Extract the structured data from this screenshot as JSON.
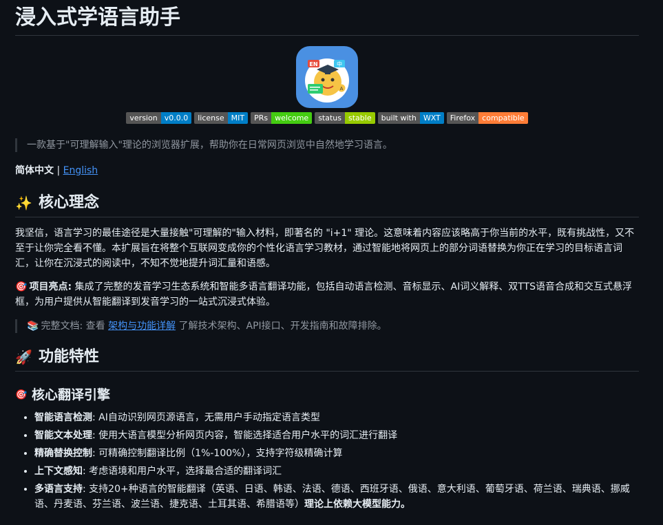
{
  "title": "浸入式学语言助手",
  "logo": {
    "tag_en": "EN",
    "tag_zh": "中",
    "tag_a": "A"
  },
  "badges": [
    {
      "label": "version",
      "value": "v0.0.0",
      "color": "#007ec6"
    },
    {
      "label": "license",
      "value": "MIT",
      "color": "#007ec6"
    },
    {
      "label": "PRs",
      "value": "welcome",
      "color": "#4c1"
    },
    {
      "label": "status",
      "value": "stable",
      "color": "#97ca00"
    },
    {
      "label": "built with",
      "value": "WXT",
      "color": "#007ec6"
    },
    {
      "label": "Firefox",
      "value": "compatible",
      "color": "#fe7d37"
    }
  ],
  "intro_quote": "一款基于\"可理解输入\"理论的浏览器扩展，帮助你在日常网页浏览中自然地学习语言。",
  "langs": {
    "current": "简体中文",
    "separator": " | ",
    "other": "English"
  },
  "section1": {
    "icon": "✨",
    "heading": "核心理念",
    "para": "我坚信，语言学习的最佳途径是大量接触\"可理解的\"输入材料，即著名的 \"i+1\" 理论。这意味着内容应该略高于你当前的水平，既有挑战性，又不至于让你完全看不懂。本扩展旨在将整个互联网变成你的个性化语言学习教材，通过智能地将网页上的部分词语替换为你正在学习的目标语言词汇，让你在沉浸式的阅读中，不知不觉地提升词汇量和语感。",
    "highlight_icon": "🎯",
    "highlight_label": "项目亮点:",
    "highlight_text": " 集成了完整的发音学习生态系统和智能多语言翻译功能，包括自动语言检测、音标显示、AI词义解释、双TTS语音合成和交互式悬浮框，为用户提供从智能翻译到发音学习的一站式沉浸式体验。",
    "doc_icon": "📚",
    "doc_label": "完整文档",
    "doc_prefix": ": 查看 ",
    "doc_link": "架构与功能详解",
    "doc_suffix": " 了解技术架构、API接口、开发指南和故障排除。"
  },
  "section2": {
    "icon": "🚀",
    "heading": "功能特性",
    "sub_icon": "🎯",
    "sub_heading": "核心翻译引擎",
    "items": [
      {
        "label": "智能语言检测",
        "text": ": AI自动识别网页源语言，无需用户手动指定语言类型"
      },
      {
        "label": "智能文本处理",
        "text": ": 使用大语言模型分析网页内容，智能选择适合用户水平的词汇进行翻译"
      },
      {
        "label": "精确替换控制",
        "text": ": 可精确控制翻译比例（1%-100%），支持字符级精确计算"
      },
      {
        "label": "上下文感知",
        "text": ": 考虑语境和用户水平，选择最合适的翻译词汇"
      },
      {
        "label": "多语言支持",
        "text": ": 支持20+种语言的智能翻译（英语、日语、韩语、法语、德语、西班牙语、俄语、意大利语、葡萄牙语、荷兰语、瑞典语、挪威语、丹麦语、芬兰语、波兰语、捷克语、土耳其语、希腊语等）",
        "tail": "理论上依赖大模型能力。"
      }
    ]
  }
}
